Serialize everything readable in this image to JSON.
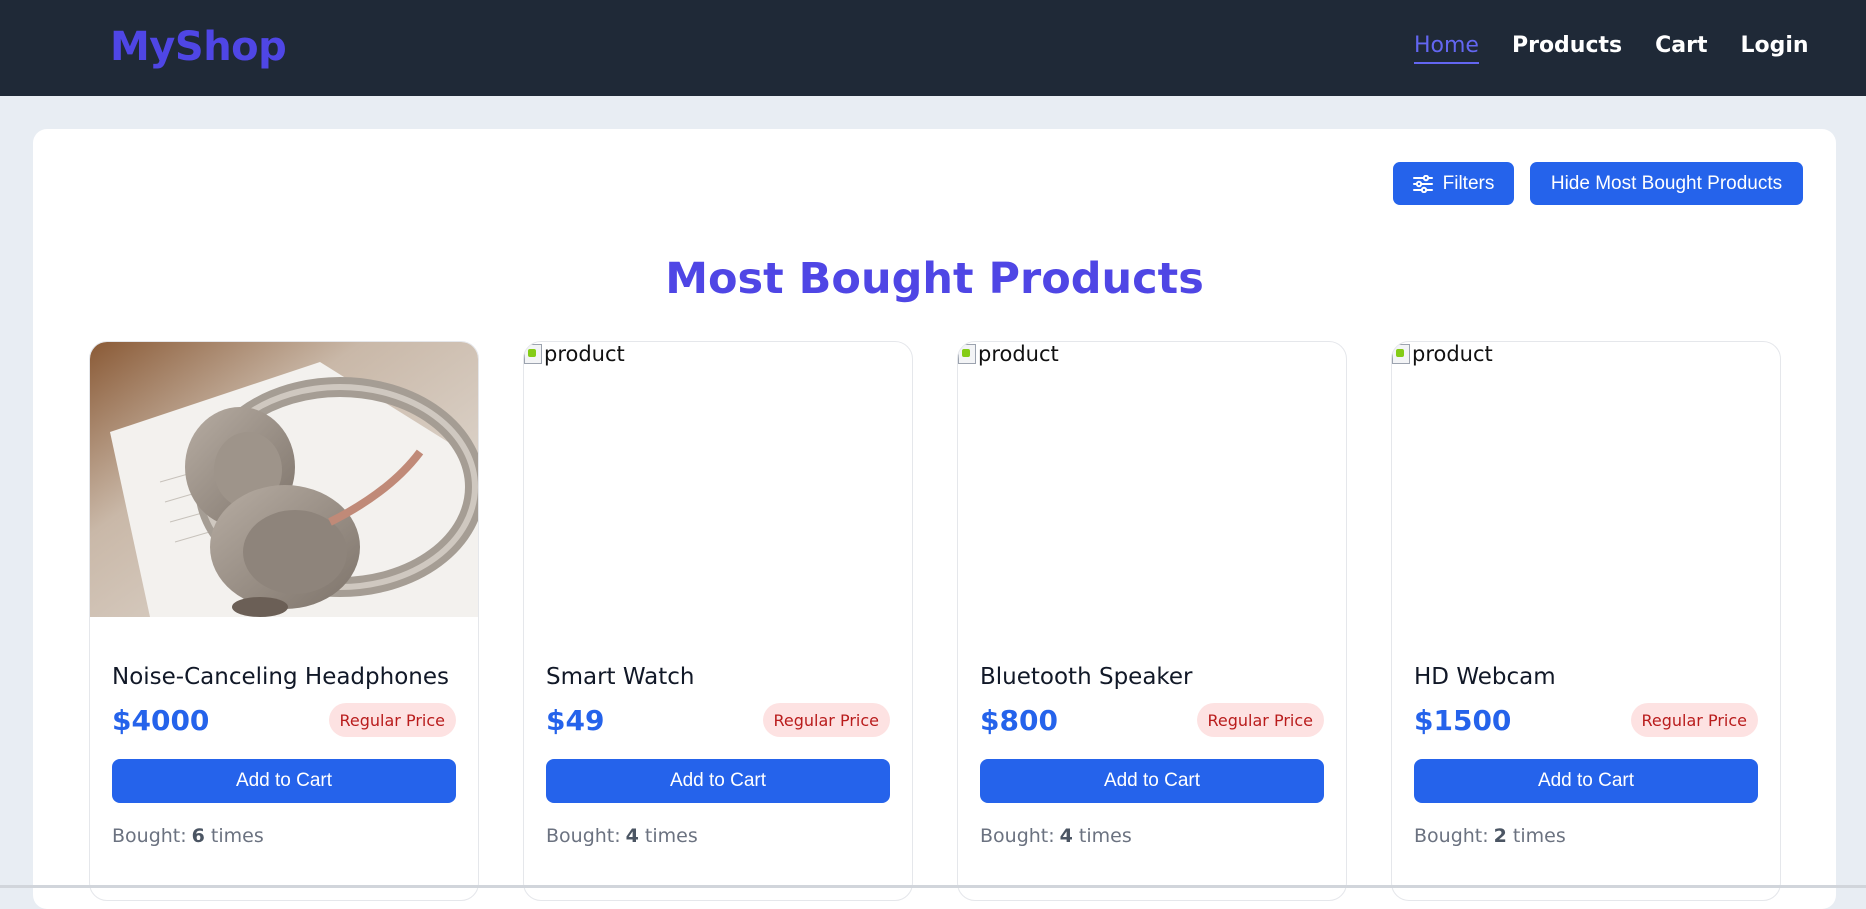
{
  "brand": "MyShop",
  "nav": [
    {
      "label": "Home",
      "active": true
    },
    {
      "label": "Products",
      "active": false
    },
    {
      "label": "Cart",
      "active": false
    },
    {
      "label": "Login",
      "active": false
    }
  ],
  "toolbar": {
    "filters_label": "Filters",
    "hide_label": "Hide Most Bought Products"
  },
  "section_title": "Most Bought Products",
  "products": [
    {
      "name": "Noise-Canceling Headphones",
      "price": "$4000",
      "badge": "Regular Price",
      "add_label": "Add to Cart",
      "bought_label": "Bought:",
      "bought_count": "6",
      "bought_suffix": "times",
      "image_alt": ""
    },
    {
      "name": "Smart Watch",
      "price": "$49",
      "badge": "Regular Price",
      "add_label": "Add to Cart",
      "bought_label": "Bought:",
      "bought_count": "4",
      "bought_suffix": "times",
      "image_alt": "product"
    },
    {
      "name": "Bluetooth Speaker",
      "price": "$800",
      "badge": "Regular Price",
      "add_label": "Add to Cart",
      "bought_label": "Bought:",
      "bought_count": "4",
      "bought_suffix": "times",
      "image_alt": "product"
    },
    {
      "name": "HD Webcam",
      "price": "$1500",
      "badge": "Regular Price",
      "add_label": "Add to Cart",
      "bought_label": "Bought:",
      "bought_count": "2",
      "bought_suffix": "times",
      "image_alt": "product"
    }
  ],
  "colors": {
    "navbar_bg": "#1f2937",
    "brand": "#4f46e5",
    "primary": "#2563eb",
    "badge_bg": "#fde2e2",
    "badge_text": "#b91c1c"
  }
}
